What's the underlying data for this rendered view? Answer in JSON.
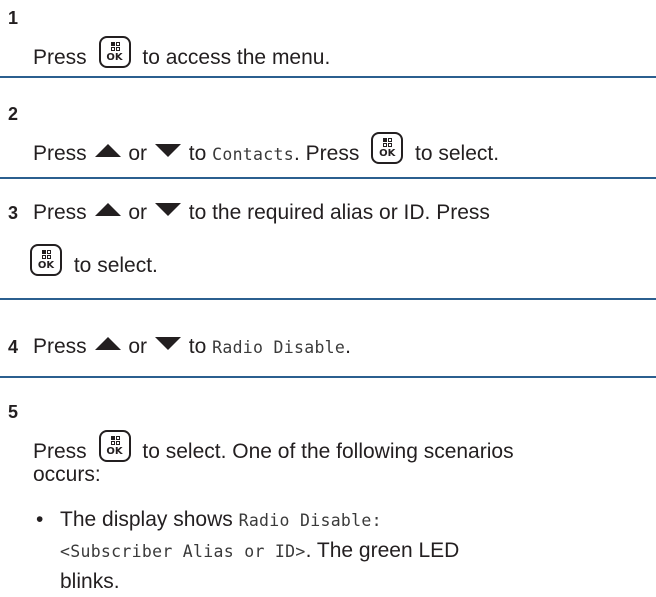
{
  "steps": [
    {
      "number": "1",
      "pre": "Press",
      "post": "to access the menu."
    },
    {
      "number": "2",
      "pre": "Press",
      "or": "or",
      "to": "to",
      "menu_item": "Contacts",
      "press": ". Press",
      "post": "to select."
    },
    {
      "number": "3",
      "pre": "Press",
      "or": "or",
      "line1_rest": "to the required alias or ID. Press",
      "post": "to select."
    },
    {
      "number": "4",
      "pre": "Press",
      "or": "or",
      "to": "to",
      "menu_item": "Radio Disable",
      "end": "."
    },
    {
      "number": "5",
      "pre": "Press",
      "post": "to select. One of the following scenarios",
      "line2": "occurs:",
      "bullet": {
        "symbol": "•",
        "lead": "The display shows",
        "display_line1": "Radio Disable:",
        "display_line2": "<Subscriber Alias or ID>",
        "rest_line2": ". The green LED",
        "line3": "blinks."
      }
    }
  ],
  "icons": {
    "ok_key": "OK"
  },
  "colors": {
    "rule": "#2b5f8f",
    "text": "#231f20"
  }
}
